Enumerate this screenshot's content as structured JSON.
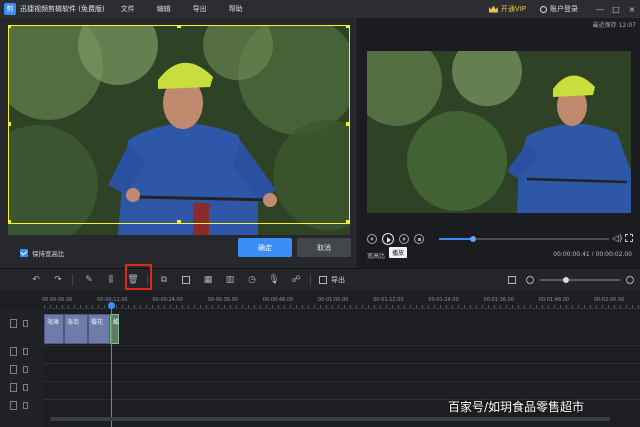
{
  "titlebar": {
    "logo_glyph": "剪",
    "app_title": "迅捷视频剪辑软件 (免费版)",
    "menu": [
      "文件",
      "编辑",
      "导出",
      "帮助"
    ],
    "vip_label": "开通VIP",
    "login_label": "账户登录",
    "window_buttons": [
      "—",
      "□",
      "×"
    ]
  },
  "crop_panel": {
    "keep_ratio_checked": true,
    "keep_ratio_label": "保持宽高比",
    "confirm_label": "确定",
    "cancel_label": "取消",
    "frame_color": "#f5f230"
  },
  "preview": {
    "save_status": "最近保存 12:07",
    "ratio_label": "宽高比",
    "tooltip": "播放",
    "time": "00:00:00.41 / 00:00:02.00",
    "progress_fraction": 0.2
  },
  "toolbar": {
    "tools": [
      "undo-icon",
      "redo-icon",
      "edit-icon",
      "split-icon",
      "delete-icon",
      "crop-icon",
      "transition-icon",
      "mosaic-icon",
      "speed-icon",
      "duration-icon",
      "record-icon",
      "voice-change-icon"
    ],
    "export_label": "导出",
    "zoom_fraction": 0.33
  },
  "timeline": {
    "ruler_labels": [
      "00:00:00.00",
      "00:00:12.00",
      "00:00:24.00",
      "00:00:36.00",
      "00:00:48.00",
      "00:01:00.00",
      "00:01:12.00",
      "00:01:24.00",
      "00:01:36.00",
      "00:01:48.00",
      "00:02:00.00"
    ],
    "clips": [
      {
        "label": "海滩",
        "selected": false
      },
      {
        "label": "海岛",
        "selected": false
      },
      {
        "label": "樱花",
        "selected": false
      },
      {
        "label": "酸",
        "selected": true
      }
    ],
    "accent_color": "#3a8ef6"
  },
  "watermark": "百家号/如玥食品零售超市"
}
